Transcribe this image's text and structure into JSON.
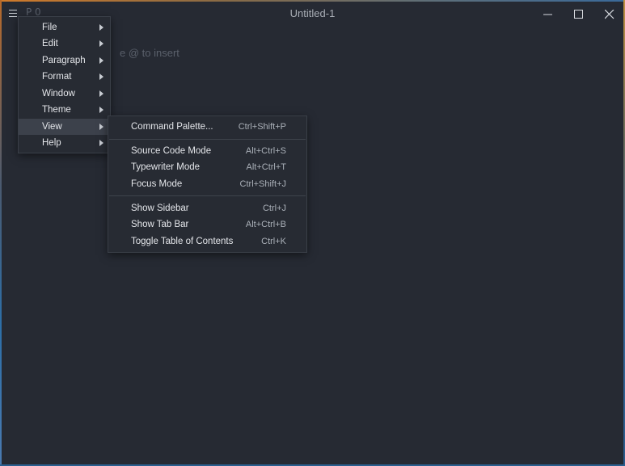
{
  "window": {
    "title": "Untitled-1",
    "paragraph_indicator": "P 0"
  },
  "editor": {
    "placeholder": "e @ to insert"
  },
  "main_menu": {
    "items": [
      {
        "label": "File",
        "has_submenu": true,
        "active": false
      },
      {
        "label": "Edit",
        "has_submenu": true,
        "active": false
      },
      {
        "label": "Paragraph",
        "has_submenu": true,
        "active": false
      },
      {
        "label": "Format",
        "has_submenu": true,
        "active": false
      },
      {
        "label": "Window",
        "has_submenu": true,
        "active": false
      },
      {
        "label": "Theme",
        "has_submenu": true,
        "active": false
      },
      {
        "label": "View",
        "has_submenu": true,
        "active": true
      },
      {
        "label": "Help",
        "has_submenu": true,
        "active": false
      }
    ]
  },
  "view_menu": {
    "groups": [
      [
        {
          "label": "Command Palette...",
          "shortcut": "Ctrl+Shift+P"
        }
      ],
      [
        {
          "label": "Source Code Mode",
          "shortcut": "Alt+Ctrl+S"
        },
        {
          "label": "Typewriter Mode",
          "shortcut": "Alt+Ctrl+T"
        },
        {
          "label": "Focus Mode",
          "shortcut": "Ctrl+Shift+J"
        }
      ],
      [
        {
          "label": "Show Sidebar",
          "shortcut": "Ctrl+J"
        },
        {
          "label": "Show Tab Bar",
          "shortcut": "Alt+Ctrl+B"
        },
        {
          "label": "Toggle Table of Contents",
          "shortcut": "Ctrl+K"
        }
      ]
    ]
  },
  "colors": {
    "background": "#262a33",
    "menu_background": "#272b33",
    "menu_active": "#3c414b",
    "text": "#e4e6ea",
    "muted_text": "#5a606b"
  },
  "icons": {
    "menu": "hamburger-icon",
    "minimize": "minimize-icon",
    "maximize": "maximize-icon",
    "close": "close-icon",
    "submenu": "chevron-right-icon"
  }
}
